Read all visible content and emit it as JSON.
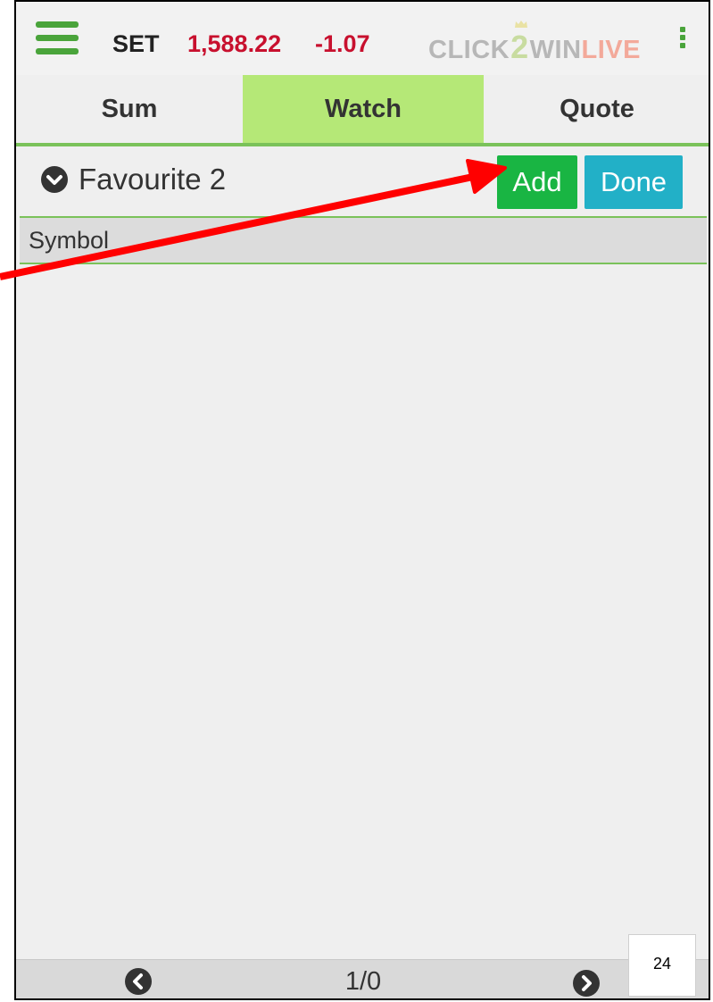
{
  "header": {
    "menu_icon": "hamburger-icon",
    "index_name": "SET",
    "index_value": "1,588.22",
    "index_change": "-1.07",
    "logo": {
      "part1": "CLICK",
      "part2": "2",
      "part3": "WIN",
      "part4": "LIVE"
    },
    "more_icon": "kebab-menu-icon"
  },
  "tabs": [
    {
      "label": "Sum",
      "active": false
    },
    {
      "label": "Watch",
      "active": true
    },
    {
      "label": "Quote",
      "active": false
    }
  ],
  "group": {
    "title": "Favourite 2",
    "dropdown_icon": "chevron-down-circle-icon"
  },
  "buttons": {
    "add": "Add",
    "done": "Done"
  },
  "table": {
    "columns": [
      "Symbol"
    ],
    "rows": []
  },
  "footer": {
    "page": "1/0",
    "prev_icon": "chevron-left-circle-icon",
    "next_icon": "chevron-right-circle-icon"
  },
  "page_number": "24",
  "colors": {
    "accent_green": "#4aa43b",
    "active_tab": "#b5e877",
    "index_red": "#c8102e",
    "add_button": "#19b543",
    "done_button": "#22b0c7",
    "annotation_arrow": "#ff0000"
  }
}
